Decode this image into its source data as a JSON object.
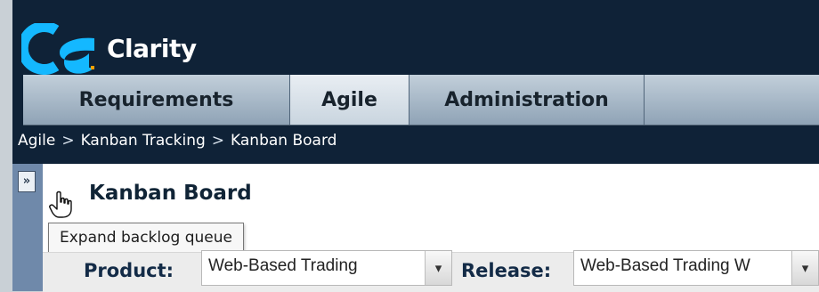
{
  "app": {
    "title": "Clarity",
    "logo_text": "ca"
  },
  "tabs": [
    {
      "label": "Requirements",
      "selected": false
    },
    {
      "label": "Agile",
      "selected": true
    },
    {
      "label": "Administration",
      "selected": false
    }
  ],
  "breadcrumb": {
    "items": [
      "Agile",
      "Kanban Tracking",
      "Kanban Board"
    ],
    "separator": ">"
  },
  "sidebar": {
    "expand_icon": "»"
  },
  "tooltip": {
    "text": "Expand backlog queue"
  },
  "page": {
    "title": "Kanban Board"
  },
  "filters": {
    "product": {
      "label": "Product:",
      "value": "Web-Based Trading"
    },
    "release": {
      "label": "Release:",
      "value": "Web-Based Trading W"
    },
    "dropdown_icon": "chevron-down-icon"
  },
  "colors": {
    "background": "#0f2237",
    "tab_selected": "#e9eef3",
    "sidebar": "#6f89aa"
  }
}
